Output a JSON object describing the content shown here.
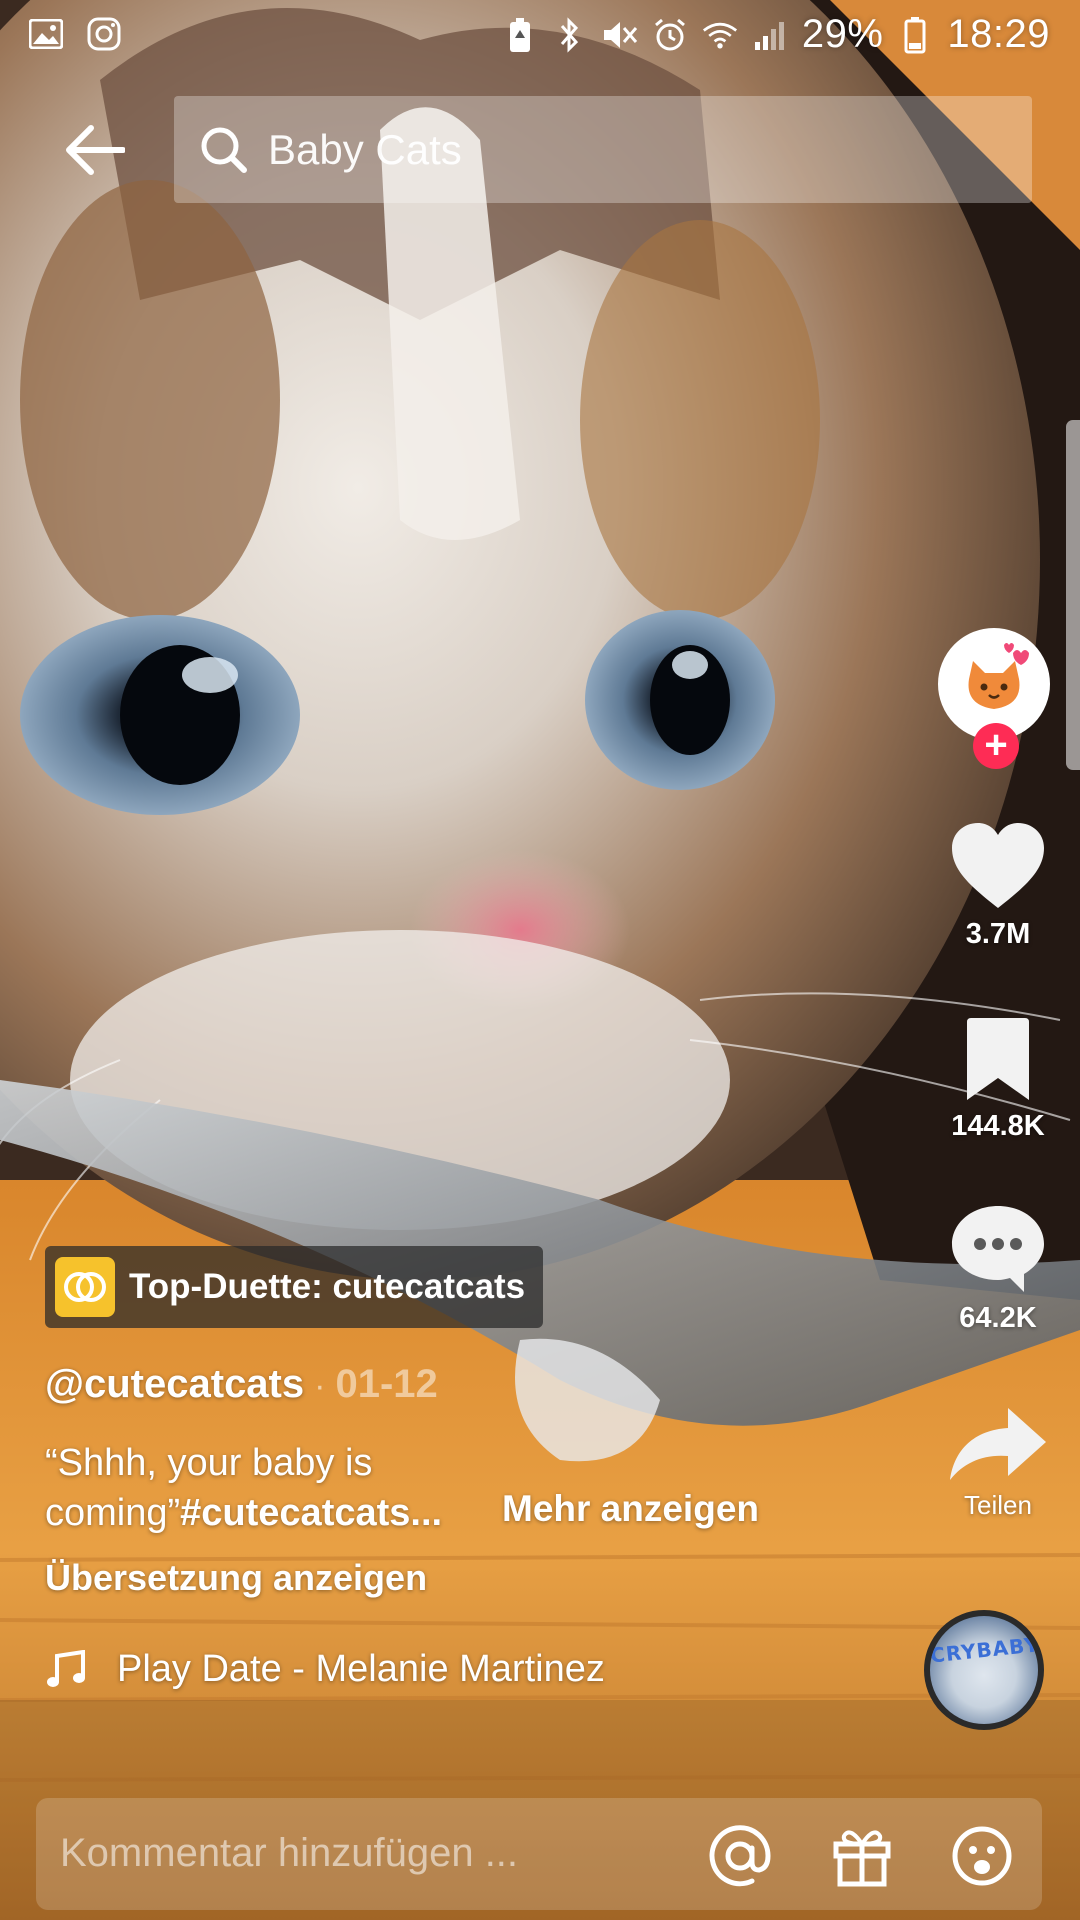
{
  "status_bar": {
    "battery_percent": "29%",
    "time": "18:29",
    "left_icons": [
      "gallery-notification-icon",
      "instagram-notification-icon"
    ],
    "right_icons": [
      "battery-saver-icon",
      "bluetooth-icon",
      "mute-icon",
      "alarm-icon",
      "wifi-icon",
      "signal-icon",
      "battery-icon"
    ]
  },
  "header": {
    "search_query": "Baby Cats"
  },
  "actions": {
    "likes": "3.7M",
    "saves": "144.8K",
    "comments": "64.2K",
    "share_label": "Teilen"
  },
  "video_info": {
    "duet_badge": "Top-Duette: cutecatcats",
    "author": "@cutecatcats",
    "separator": "·",
    "date": "01-12",
    "caption_text": "“Shhh, your baby is coming”",
    "caption_hashtag": "#cutecatcats...",
    "more_label": "Mehr anzeigen",
    "translate_label": "Übersetzung anzeigen",
    "music": "Play Date - Melanie Martinez",
    "album_art_text": "CRYBABY"
  },
  "comment_bar": {
    "placeholder": "Kommentar hinzufügen ..."
  },
  "colors": {
    "accent_red": "#fe2c55",
    "duet_yellow": "#f6c22c"
  }
}
